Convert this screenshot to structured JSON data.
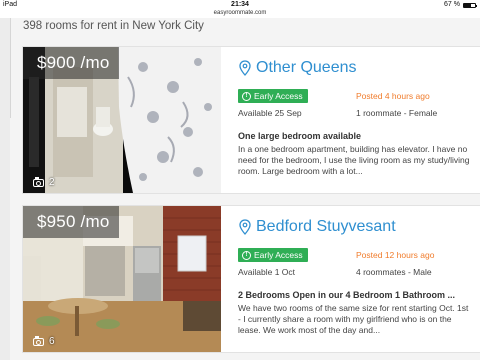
{
  "status_bar": {
    "device": "iPad",
    "time": "21:34",
    "battery": "67 %",
    "url": "easyroommate.com"
  },
  "heading": "398 rooms for rent in New York City",
  "listings": [
    {
      "price": "$900 /mo",
      "photo_count": "2",
      "title": "Other Queens",
      "badge": "Early Access",
      "posted": "Posted 4 hours ago",
      "available": "Available 25 Sep",
      "roommates": "1 roommate - Female",
      "listing_title": "One large bedroom available",
      "description": "In a one bedroom apartment, building has elevator. I have no need for the bedroom, I use the living room as my study/living room. Large bedroom with a lot..."
    },
    {
      "price": "$950 /mo",
      "photo_count": "6",
      "title": "Bedford Stuyvesant",
      "badge": "Early Access",
      "posted": "Posted 12 hours ago",
      "available": "Available 1 Oct",
      "roommates": "4 roommates - Male",
      "listing_title": "2 Bedrooms Open in our 4 Bedroom 1 Bathroom ...",
      "description": "We have two rooms of the same size for rent starting Oct. 1st - I currently share a room with my girlfriend who is on the lease. We work most of the day and..."
    }
  ],
  "colors": {
    "accent": "#2f8fd0",
    "badge": "#2fae55",
    "posted": "#f07c2c"
  }
}
